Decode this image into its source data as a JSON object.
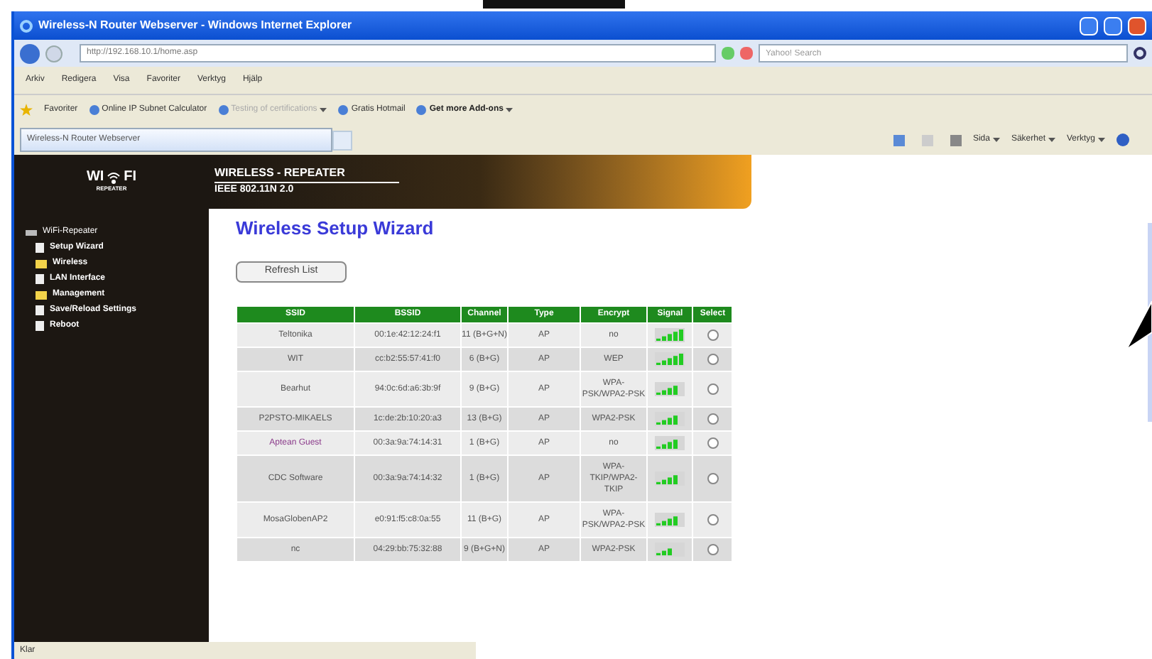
{
  "window": {
    "title": "Wireless-N Router Webserver - Windows Internet Explorer"
  },
  "address_bar": {
    "value": "http://192.168.10.1/home.asp"
  },
  "search": {
    "placeholder": "Yahoo! Search"
  },
  "menu": [
    "Arkiv",
    "Redigera",
    "Visa",
    "Favoriter",
    "Verktyg",
    "Hjälp"
  ],
  "favorites_bar": {
    "label": "Favoriter",
    "items": [
      {
        "label": "Online IP Subnet Calculator",
        "kind": "link"
      },
      {
        "label": "Testing of certifications",
        "kind": "dropdown"
      },
      {
        "label": "Gratis Hotmail",
        "kind": "link"
      },
      {
        "label": "Get more Add-ons",
        "kind": "dropdown"
      }
    ]
  },
  "tab": {
    "title": "Wireless-N Router Webserver"
  },
  "command_bar": [
    "Sida",
    "Säkerhet",
    "Verktyg"
  ],
  "logo": {
    "left": "WI",
    "right": "FI",
    "sub": "REPEATER"
  },
  "header": {
    "title": "WIRELESS - REPEATER",
    "subtitle": "IEEE 802.11N 2.0"
  },
  "sidebar": {
    "root": "WiFi-Repeater",
    "children": [
      {
        "label": "Setup Wizard",
        "kind": "page"
      },
      {
        "label": "Wireless",
        "kind": "folder"
      },
      {
        "label": "LAN Interface",
        "kind": "page"
      },
      {
        "label": "Management",
        "kind": "folder"
      },
      {
        "label": "Save/Reload Settings",
        "kind": "page"
      },
      {
        "label": "Reboot",
        "kind": "page"
      }
    ]
  },
  "page": {
    "title": "Wireless Setup Wizard",
    "refresh_button": "Refresh List"
  },
  "table": {
    "columns": [
      "SSID",
      "BSSID",
      "Channel",
      "Type",
      "Encrypt",
      "Signal",
      "Select"
    ],
    "rows": [
      {
        "ssid": "Teltonika",
        "bssid": "00:1e:42:12:24:f1",
        "channel": "11 (B+G+N)",
        "type": "AP",
        "encrypt": "no",
        "level": 1,
        "selected": false
      },
      {
        "ssid": "WIT",
        "bssid": "cc:b2:55:57:41:f0",
        "channel": "6 (B+G)",
        "type": "AP",
        "encrypt": "WEP",
        "level": 1,
        "selected": false
      },
      {
        "ssid": "Bearhut",
        "bssid": "94:0c:6d:a6:3b:9f",
        "channel": "9 (B+G)",
        "type": "AP",
        "encrypt": "WPA-PSK/WPA2-PSK",
        "level": 0.8,
        "selected": false
      },
      {
        "ssid": "P2PSTO-MIKAELS",
        "bssid": "1c:de:2b:10:20:a3",
        "channel": "13 (B+G)",
        "type": "AP",
        "encrypt": "WPA2-PSK",
        "level": 0.8,
        "selected": false
      },
      {
        "ssid": "Aptean Guest",
        "bssid": "00:3a:9a:74:14:31",
        "channel": "1 (B+G)",
        "type": "AP",
        "encrypt": "no",
        "level": 0.8,
        "selected": false
      },
      {
        "ssid": "CDC Software",
        "bssid": "00:3a:9a:74:14:32",
        "channel": "1 (B+G)",
        "type": "AP",
        "encrypt": "WPA-TKIP/WPA2-TKIP",
        "level": 0.8,
        "selected": false
      },
      {
        "ssid": "MosaGlobenAP2",
        "bssid": "e0:91:f5:c8:0a:55",
        "channel": "11 (B+G)",
        "type": "AP",
        "encrypt": "WPA-PSK/WPA2-PSK",
        "level": 0.8,
        "selected": false
      },
      {
        "ssid": "nc",
        "bssid": "04:29:bb:75:32:88",
        "channel": "9 (B+G+N)",
        "type": "AP",
        "encrypt": "WPA2-PSK",
        "level": 0.6,
        "selected": false
      }
    ]
  },
  "status_bar": {
    "text": "Klar"
  }
}
